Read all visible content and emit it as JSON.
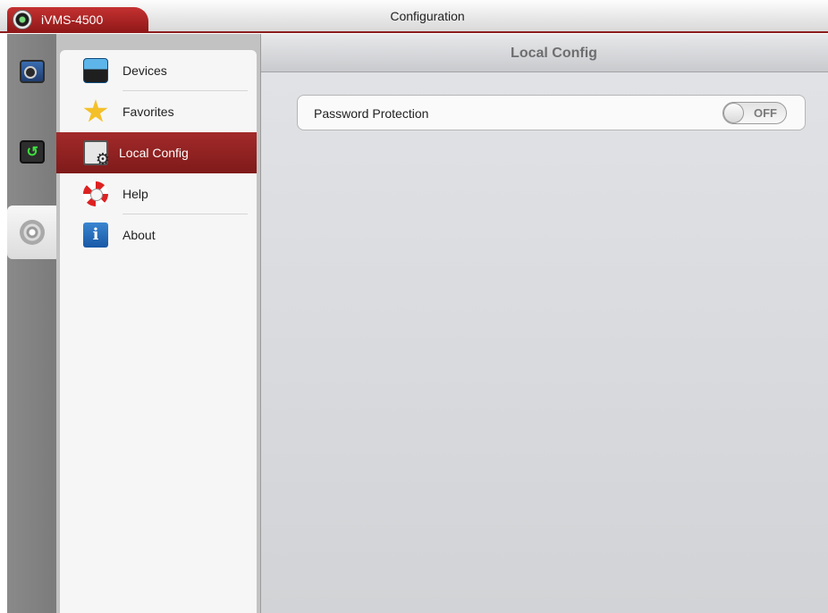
{
  "titlebar": {
    "app_name": "iVMS-4500",
    "screen_title": "Configuration",
    "logo_icon": "camera-lens-icon"
  },
  "rail": {
    "items": [
      {
        "name": "live-view",
        "icon": "monitor-icon",
        "active": false
      },
      {
        "name": "playback",
        "icon": "playback-icon",
        "active": false
      },
      {
        "name": "configuration",
        "icon": "settings-icon",
        "active": true
      }
    ]
  },
  "menu": {
    "items": [
      {
        "label": "Devices",
        "icon": "devices-icon",
        "active": false
      },
      {
        "label": "Favorites",
        "icon": "star-icon",
        "active": false
      },
      {
        "label": "Local Config",
        "icon": "local-config-icon",
        "active": true
      },
      {
        "label": "Help",
        "icon": "lifebuoy-icon",
        "active": false
      },
      {
        "label": "About",
        "icon": "info-book-icon",
        "active": false
      }
    ]
  },
  "content": {
    "header_title": "Local Config",
    "settings": [
      {
        "label": "Password Protection",
        "toggle_state": "OFF",
        "enabled": false
      }
    ]
  },
  "colors": {
    "accent_red": "#8e1717",
    "rail_gray": "#7b7b7b",
    "content_bg": "#d8dadd"
  }
}
